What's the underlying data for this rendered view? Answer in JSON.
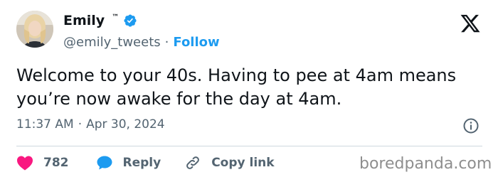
{
  "author": {
    "name": "Emily",
    "tm": "™",
    "handle": "@emily_tweets",
    "separator": "·",
    "follow_label": "Follow",
    "verified_color": "#1d9bf0"
  },
  "tweet": {
    "text": "Welcome to your 40s. Having to pee at 4am means you’re now awake for the day at 4am.",
    "time": "11:37 AM",
    "meta_separator": "·",
    "date": "Apr 30, 2024"
  },
  "actions": {
    "like_count": "782",
    "reply_label": "Reply",
    "copy_label": "Copy link"
  },
  "icons": {
    "close": "x-logo-icon",
    "info": "info-icon",
    "like": "heart-icon",
    "reply": "speech-bubble-icon",
    "copy": "link-icon"
  },
  "colors": {
    "like": "#f91880",
    "reply": "#1d9bf0",
    "follow": "#1d9bf0",
    "muted": "#536471"
  },
  "watermark": "boredpanda.com"
}
